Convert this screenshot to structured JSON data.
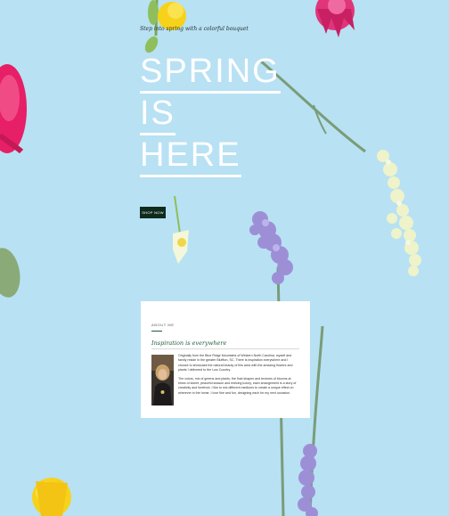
{
  "hero": {
    "kicker": "Step into spring with a colorful bouquet",
    "title_lines": [
      "SPRING",
      "IS",
      "HERE"
    ],
    "button_label": "SHOP NOW"
  },
  "about": {
    "eyebrow": "ABOUT ME",
    "heading": "Inspiration is everywhere",
    "paragraphs": [
      "Originally from the Blue Ridge Mountains of Western North Carolina, myself and family reside in the greater Bluffton, SC. There is inspiration everywhere and I choose to showcase the natural beauty of this area with the amazing flowers and plants I delivered to the Low Country.",
      "The colors, mix of greens and plants, the fluid shapes and textures of blooms at times of sweet, peaceful season and enticing luxury, each arrangement is a story of creativity and forefront. I like to mix different mediums to create a unique effect on wherever in the home. I love fine and fun, designing each for my next occasion."
    ]
  },
  "colors": {
    "background": "#b8e1f3",
    "button": "#0f2b1e",
    "accent_green": "#1e5b3c",
    "card": "#ffffff"
  }
}
